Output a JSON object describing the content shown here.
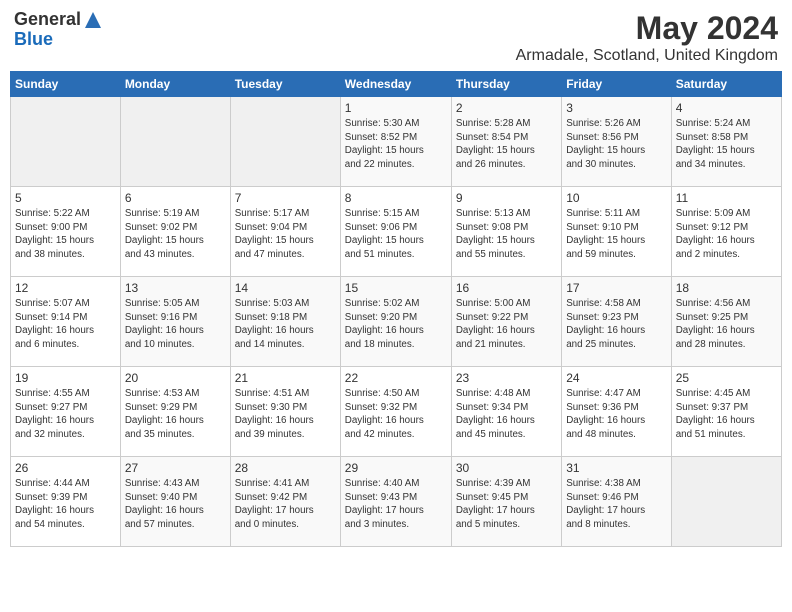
{
  "header": {
    "logo_general": "General",
    "logo_blue": "Blue",
    "month_title": "May 2024",
    "location": "Armadale, Scotland, United Kingdom"
  },
  "weekdays": [
    "Sunday",
    "Monday",
    "Tuesday",
    "Wednesday",
    "Thursday",
    "Friday",
    "Saturday"
  ],
  "weeks": [
    [
      {
        "day": "",
        "info": ""
      },
      {
        "day": "",
        "info": ""
      },
      {
        "day": "",
        "info": ""
      },
      {
        "day": "1",
        "info": "Sunrise: 5:30 AM\nSunset: 8:52 PM\nDaylight: 15 hours\nand 22 minutes."
      },
      {
        "day": "2",
        "info": "Sunrise: 5:28 AM\nSunset: 8:54 PM\nDaylight: 15 hours\nand 26 minutes."
      },
      {
        "day": "3",
        "info": "Sunrise: 5:26 AM\nSunset: 8:56 PM\nDaylight: 15 hours\nand 30 minutes."
      },
      {
        "day": "4",
        "info": "Sunrise: 5:24 AM\nSunset: 8:58 PM\nDaylight: 15 hours\nand 34 minutes."
      }
    ],
    [
      {
        "day": "5",
        "info": "Sunrise: 5:22 AM\nSunset: 9:00 PM\nDaylight: 15 hours\nand 38 minutes."
      },
      {
        "day": "6",
        "info": "Sunrise: 5:19 AM\nSunset: 9:02 PM\nDaylight: 15 hours\nand 43 minutes."
      },
      {
        "day": "7",
        "info": "Sunrise: 5:17 AM\nSunset: 9:04 PM\nDaylight: 15 hours\nand 47 minutes."
      },
      {
        "day": "8",
        "info": "Sunrise: 5:15 AM\nSunset: 9:06 PM\nDaylight: 15 hours\nand 51 minutes."
      },
      {
        "day": "9",
        "info": "Sunrise: 5:13 AM\nSunset: 9:08 PM\nDaylight: 15 hours\nand 55 minutes."
      },
      {
        "day": "10",
        "info": "Sunrise: 5:11 AM\nSunset: 9:10 PM\nDaylight: 15 hours\nand 59 minutes."
      },
      {
        "day": "11",
        "info": "Sunrise: 5:09 AM\nSunset: 9:12 PM\nDaylight: 16 hours\nand 2 minutes."
      }
    ],
    [
      {
        "day": "12",
        "info": "Sunrise: 5:07 AM\nSunset: 9:14 PM\nDaylight: 16 hours\nand 6 minutes."
      },
      {
        "day": "13",
        "info": "Sunrise: 5:05 AM\nSunset: 9:16 PM\nDaylight: 16 hours\nand 10 minutes."
      },
      {
        "day": "14",
        "info": "Sunrise: 5:03 AM\nSunset: 9:18 PM\nDaylight: 16 hours\nand 14 minutes."
      },
      {
        "day": "15",
        "info": "Sunrise: 5:02 AM\nSunset: 9:20 PM\nDaylight: 16 hours\nand 18 minutes."
      },
      {
        "day": "16",
        "info": "Sunrise: 5:00 AM\nSunset: 9:22 PM\nDaylight: 16 hours\nand 21 minutes."
      },
      {
        "day": "17",
        "info": "Sunrise: 4:58 AM\nSunset: 9:23 PM\nDaylight: 16 hours\nand 25 minutes."
      },
      {
        "day": "18",
        "info": "Sunrise: 4:56 AM\nSunset: 9:25 PM\nDaylight: 16 hours\nand 28 minutes."
      }
    ],
    [
      {
        "day": "19",
        "info": "Sunrise: 4:55 AM\nSunset: 9:27 PM\nDaylight: 16 hours\nand 32 minutes."
      },
      {
        "day": "20",
        "info": "Sunrise: 4:53 AM\nSunset: 9:29 PM\nDaylight: 16 hours\nand 35 minutes."
      },
      {
        "day": "21",
        "info": "Sunrise: 4:51 AM\nSunset: 9:30 PM\nDaylight: 16 hours\nand 39 minutes."
      },
      {
        "day": "22",
        "info": "Sunrise: 4:50 AM\nSunset: 9:32 PM\nDaylight: 16 hours\nand 42 minutes."
      },
      {
        "day": "23",
        "info": "Sunrise: 4:48 AM\nSunset: 9:34 PM\nDaylight: 16 hours\nand 45 minutes."
      },
      {
        "day": "24",
        "info": "Sunrise: 4:47 AM\nSunset: 9:36 PM\nDaylight: 16 hours\nand 48 minutes."
      },
      {
        "day": "25",
        "info": "Sunrise: 4:45 AM\nSunset: 9:37 PM\nDaylight: 16 hours\nand 51 minutes."
      }
    ],
    [
      {
        "day": "26",
        "info": "Sunrise: 4:44 AM\nSunset: 9:39 PM\nDaylight: 16 hours\nand 54 minutes."
      },
      {
        "day": "27",
        "info": "Sunrise: 4:43 AM\nSunset: 9:40 PM\nDaylight: 16 hours\nand 57 minutes."
      },
      {
        "day": "28",
        "info": "Sunrise: 4:41 AM\nSunset: 9:42 PM\nDaylight: 17 hours\nand 0 minutes."
      },
      {
        "day": "29",
        "info": "Sunrise: 4:40 AM\nSunset: 9:43 PM\nDaylight: 17 hours\nand 3 minutes."
      },
      {
        "day": "30",
        "info": "Sunrise: 4:39 AM\nSunset: 9:45 PM\nDaylight: 17 hours\nand 5 minutes."
      },
      {
        "day": "31",
        "info": "Sunrise: 4:38 AM\nSunset: 9:46 PM\nDaylight: 17 hours\nand 8 minutes."
      },
      {
        "day": "",
        "info": ""
      }
    ]
  ]
}
